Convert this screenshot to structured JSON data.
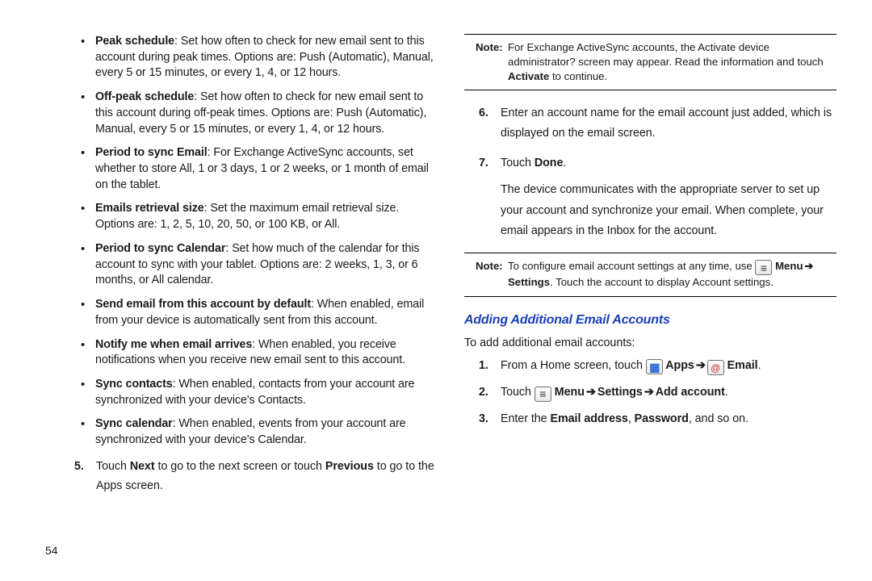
{
  "left": {
    "bullets": [
      {
        "term": "Peak schedule",
        "desc": ": Set how often to check for new email sent to this account during peak times. Options are: Push (Automatic), Manual, every 5 or 15 minutes, or every 1, 4, or 12 hours."
      },
      {
        "term": "Off-peak schedule",
        "desc": ": Set how often to check for new email sent to this account during off-peak times. Options are: Push (Automatic), Manual, every 5 or 15 minutes, or every 1, 4, or 12 hours."
      },
      {
        "term": "Period to sync Email",
        "desc": ": For Exchange ActiveSync accounts, set whether to store All, 1 or 3 days, 1 or 2 weeks, or 1 month of email on the tablet."
      },
      {
        "term": "Emails retrieval size",
        "desc": ": Set the maximum email retrieval size. Options are: 1, 2, 5, 10, 20, 50, or 100 KB, or All."
      },
      {
        "term": "Period to sync Calendar",
        "desc": ": Set how much of the calendar for this account to sync with your tablet. Options are: 2 weeks, 1, 3, or 6 months, or All calendar."
      },
      {
        "term": "Send email from this account by default",
        "desc": ": When enabled, email from your device is automatically sent from this account."
      },
      {
        "term": "Notify me when email arrives",
        "desc": ": When enabled, you receive notifications when you receive new email sent to this account."
      },
      {
        "term": "Sync contacts",
        "desc": ": When enabled, contacts from your account are synchronized with your device's Contacts."
      },
      {
        "term": "Sync calendar",
        "desc": ": When enabled, events from your account are synchronized with your device's Calendar."
      }
    ],
    "step5_num": "5.",
    "step5_a": "Touch ",
    "step5_b": "Next",
    "step5_c": " to go to the next screen or touch ",
    "step5_d": "Previous",
    "step5_e": " to go to the Apps screen."
  },
  "right": {
    "note1_label": "Note:",
    "note1_a": " For Exchange ActiveSync accounts, the Activate device administrator? screen may appear. Read the information and touch ",
    "note1_b": "Activate",
    "note1_c": " to continue.",
    "step6_num": "6.",
    "step6": "Enter an account name for the email account just added, which is displayed on the email screen.",
    "step7_num": "7.",
    "step7_a": "Touch ",
    "step7_b": "Done",
    "step7_c": ".",
    "step7_body": "The device communicates with the appropriate server to set up your account and synchronize your email. When complete, your email appears in the Inbox for the account.",
    "note2_label": "Note:",
    "note2_a": " To configure email account settings at any time, use ",
    "note2_menu": " Menu",
    "note2_arrow": " ➔ ",
    "note2_b": "Settings",
    "note2_c": ". Touch the account to display Account settings.",
    "section_heading": "Adding Additional Email Accounts",
    "intro": "To add additional email accounts:",
    "s1_num": "1.",
    "s1_a": "From a Home screen, touch ",
    "s1_apps": " Apps",
    "s1_arrow": " ➔ ",
    "s1_email": " Email",
    "s1_end": ".",
    "s2_num": "2.",
    "s2_a": "Touch ",
    "s2_menu": " Menu",
    "s2_arrow1": " ➔ ",
    "s2_settings": "Settings",
    "s2_arrow2": " ➔ ",
    "s2_add": "Add account",
    "s2_end": ".",
    "s3_num": "3.",
    "s3_a": "Enter the ",
    "s3_b": "Email address",
    "s3_c": ", ",
    "s3_d": "Password",
    "s3_e": ", and so on."
  },
  "page_number": "54"
}
